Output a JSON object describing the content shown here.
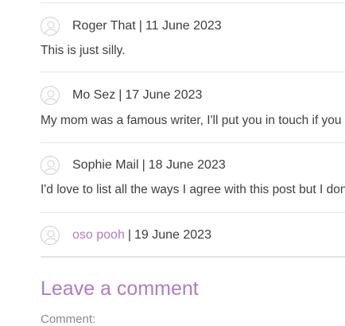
{
  "comments": [
    {
      "author": "Roger That",
      "author_is_link": false,
      "separator": "|",
      "date": "11 June 2023",
      "text": "This is just silly."
    },
    {
      "author": "Mo Sez",
      "author_is_link": false,
      "separator": "|",
      "date": "17 June 2023",
      "text": "My mom was a famous writer, I'll put you in touch if you"
    },
    {
      "author": "Sophie Mail",
      "author_is_link": false,
      "separator": "|",
      "date": "18 June 2023",
      "text": "I'd love to list all the ways I agree with this post but I don"
    },
    {
      "author": "oso pooh",
      "author_is_link": true,
      "separator": "|",
      "date": "19 June 2023",
      "text": ""
    }
  ],
  "leave_comment": {
    "heading": "Leave a comment",
    "comment_label": "Comment:"
  },
  "colors": {
    "accent": "#b07cc6",
    "text": "#3d3d3d",
    "divider": "#e6e6e6"
  },
  "icons": {
    "avatar": "default-user-avatar-icon"
  }
}
